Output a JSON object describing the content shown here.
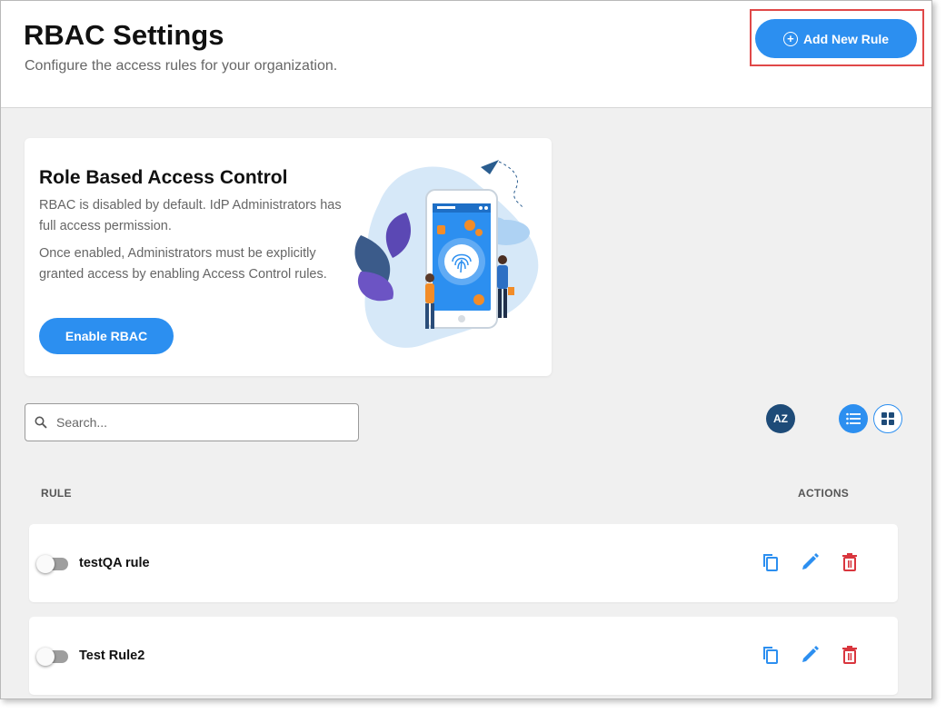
{
  "header": {
    "title": "RBAC Settings",
    "subtitle": "Configure the access rules for your organization.",
    "add_rule_label": "Add New Rule"
  },
  "rbac_card": {
    "title": "Role Based Access Control",
    "paragraph1": "RBAC is disabled by default. IdP Administrators has full access permission.",
    "paragraph2": "Once enabled, Administrators must be explicitly granted access by enabling Access Control rules.",
    "enable_label": "Enable RBAC"
  },
  "search": {
    "placeholder": "Search...",
    "value": ""
  },
  "toolbar": {
    "sort_label": "AZ",
    "view_mode": "list"
  },
  "table": {
    "columns": [
      "RULE",
      "ACTIONS"
    ],
    "rows": [
      {
        "name": "testQA rule",
        "enabled": false
      },
      {
        "name": "Test Rule2",
        "enabled": false
      }
    ]
  },
  "colors": {
    "accent": "#2c8ff0",
    "sort_button": "#1e4b78",
    "delete": "#d9363e",
    "highlight": "#e04848"
  },
  "icons": [
    "plus-circle-icon",
    "search-icon",
    "sort-az-icon",
    "list-view-icon",
    "grid-view-icon",
    "copy-icon",
    "edit-icon",
    "delete-icon"
  ]
}
